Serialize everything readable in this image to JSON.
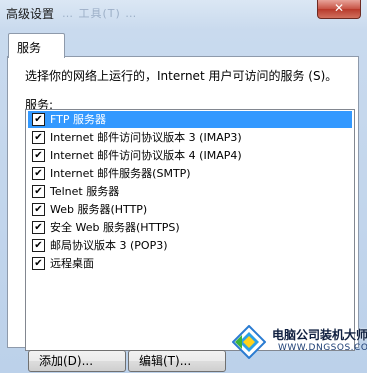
{
  "window": {
    "title": "高级设置",
    "background_menu": "…  工具(T) …"
  },
  "tab": {
    "label": "服务"
  },
  "panel": {
    "instructions": "选择你的网络上运行的，Internet 用户可访问的服务 (S)。",
    "services_label": "服务:",
    "services": [
      {
        "label": "FTP 服务器",
        "checked": true,
        "selected": true
      },
      {
        "label": "Internet 邮件访问协议版本 3 (IMAP3)",
        "checked": true
      },
      {
        "label": "Internet 邮件访问协议版本 4 (IMAP4)",
        "checked": true
      },
      {
        "label": "Internet 邮件服务器(SMTP)",
        "checked": true
      },
      {
        "label": "Telnet 服务器",
        "checked": true
      },
      {
        "label": "Web 服务器(HTTP)",
        "checked": true
      },
      {
        "label": "安全 Web 服务器(HTTPS)",
        "checked": true
      },
      {
        "label": "邮局协议版本 3 (POP3)",
        "checked": true
      },
      {
        "label": "远程桌面",
        "checked": true
      }
    ]
  },
  "buttons": {
    "add": "添加(D)...",
    "edit": "编辑(T)..."
  },
  "close_label": "✕",
  "watermark": {
    "title": "电脑公司装机大师",
    "url": "WWW.DNGSOS.COM"
  },
  "colors": {
    "selection": "#3399ff",
    "close": "#c75244",
    "titlebar": "#c9daee"
  }
}
